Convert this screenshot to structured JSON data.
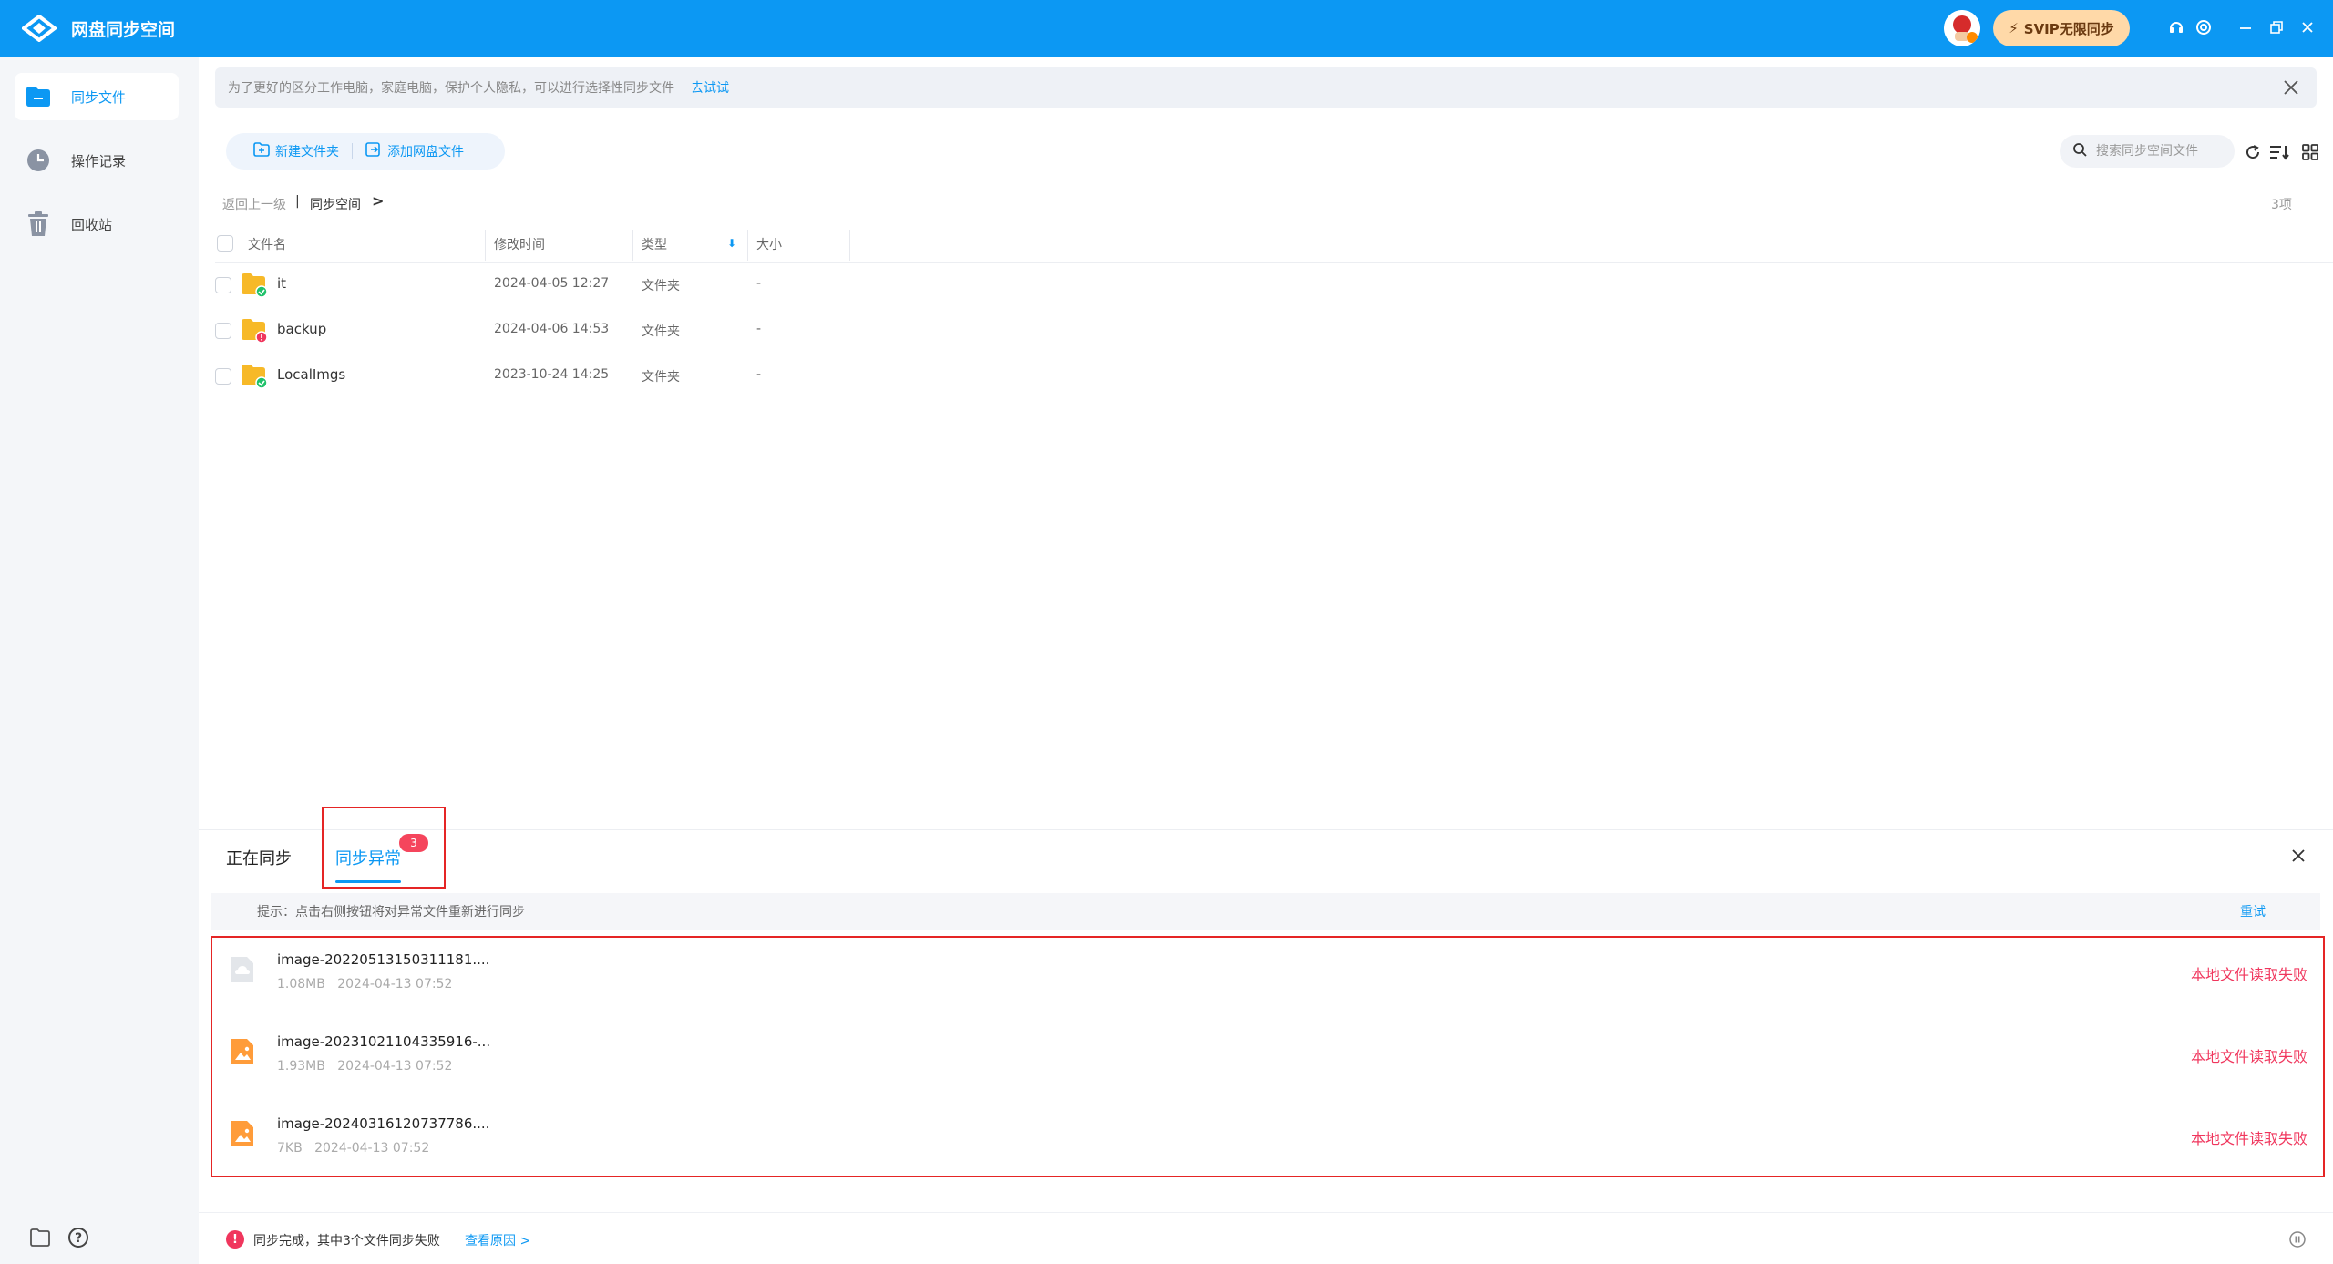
{
  "app": {
    "title": "网盘同步空间",
    "svip_label": "SVIP无限同步"
  },
  "sidebar": {
    "items": [
      {
        "label": "同步文件",
        "icon": "folder-icon",
        "active": true
      },
      {
        "label": "操作记录",
        "icon": "clock-icon",
        "active": false
      },
      {
        "label": "回收站",
        "icon": "trash-icon",
        "active": false
      }
    ]
  },
  "banner": {
    "text": "为了更好的区分工作电脑，家庭电脑，保护个人隐私，可以进行选择性同步文件",
    "link": "去试试"
  },
  "toolbar": {
    "new_folder": "新建文件夹",
    "add_cloud_file": "添加网盘文件",
    "search_placeholder": "搜索同步空间文件"
  },
  "breadcrumb": {
    "back": "返回上一级",
    "separator": "|",
    "current": "同步空间",
    "chevron": ">"
  },
  "item_count": "3项",
  "table": {
    "columns": [
      "文件名",
      "修改时间",
      "类型",
      "大小"
    ],
    "sort_indicator": "⬇",
    "rows": [
      {
        "name": "it",
        "modified": "2024-04-05 12:27",
        "type": "文件夹",
        "size": "-",
        "status": "synced"
      },
      {
        "name": "backup",
        "modified": "2024-04-06 14:53",
        "type": "文件夹",
        "size": "-",
        "status": "error"
      },
      {
        "name": "LocalImgs",
        "modified": "2023-10-24 14:25",
        "type": "文件夹",
        "size": "-",
        "status": "synced"
      }
    ]
  },
  "panel": {
    "tabs": [
      {
        "label": "正在同步",
        "active": false
      },
      {
        "label": "同步异常",
        "active": true,
        "badge": "3"
      }
    ],
    "hint": "提示：点击右侧按钮将对异常文件重新进行同步",
    "retry": "重试",
    "errors": [
      {
        "name": "image-20220513150311181....",
        "size": "1.08MB",
        "time": "2024-04-13 07:52",
        "status": "本地文件读取失败",
        "icon": "cloud-file-icon"
      },
      {
        "name": "image-20231021104335916-...",
        "size": "1.93MB",
        "time": "2024-04-13 07:52",
        "status": "本地文件读取失败",
        "icon": "image-file-icon"
      },
      {
        "name": "image-20240316120737786....",
        "size": "7KB",
        "time": "2024-04-13 07:52",
        "status": "本地文件读取失败",
        "icon": "image-file-icon"
      }
    ]
  },
  "status_bar": {
    "text": "同步完成，其中3个文件同步失败",
    "link": "查看原因 >"
  },
  "colors": {
    "brand": "#0c98f3",
    "error": "#f0365d",
    "highlight_box": "#e52525",
    "success": "#20c26b"
  }
}
